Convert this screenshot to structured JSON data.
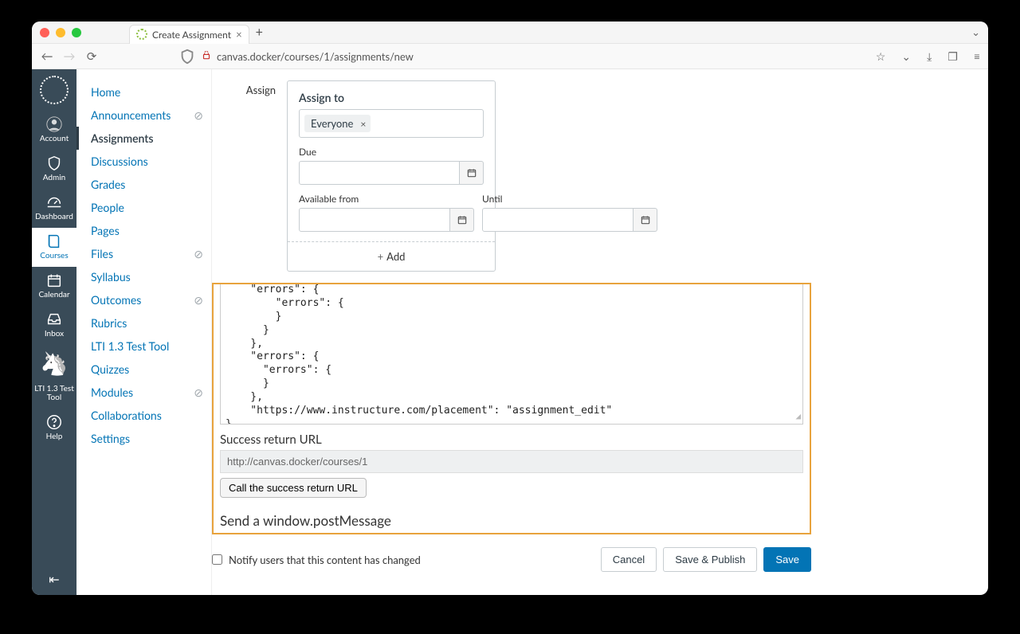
{
  "browser": {
    "tab_title": "Create Assignment",
    "url": "canvas.docker/courses/1/assignments/new"
  },
  "global_nav": {
    "account": "Account",
    "admin": "Admin",
    "dashboard": "Dashboard",
    "courses": "Courses",
    "calendar": "Calendar",
    "inbox": "Inbox",
    "lti_tool": "LTI 1.3 Test Tool",
    "help": "Help"
  },
  "course_nav": {
    "home": "Home",
    "announcements": "Announcements",
    "assignments": "Assignments",
    "discussions": "Discussions",
    "grades": "Grades",
    "people": "People",
    "pages": "Pages",
    "files": "Files",
    "syllabus": "Syllabus",
    "outcomes": "Outcomes",
    "rubrics": "Rubrics",
    "lti_tool": "LTI 1.3 Test Tool",
    "quizzes": "Quizzes",
    "modules": "Modules",
    "collaborations": "Collaborations",
    "settings": "Settings"
  },
  "assign": {
    "label": "Assign",
    "assign_to": "Assign to",
    "token": "Everyone",
    "due_label": "Due",
    "from_label": "Available from",
    "until_label": "Until",
    "add": "Add"
  },
  "tool": {
    "json": "    \"errors\": {\n        \"errors\": {\n        }\n      }\n    },\n    \"errors\": {\n      \"errors\": {\n      }\n    },\n    \"https://www.instructure.com/placement\": \"assignment_edit\"\n}",
    "success_label": "Success return URL",
    "success_url": "http://canvas.docker/courses/1",
    "call_btn": "Call the success return URL",
    "post_msg": "Send a window.postMessage"
  },
  "footer": {
    "notify": "Notify users that this content has changed",
    "cancel": "Cancel",
    "save_publish": "Save & Publish",
    "save": "Save"
  }
}
